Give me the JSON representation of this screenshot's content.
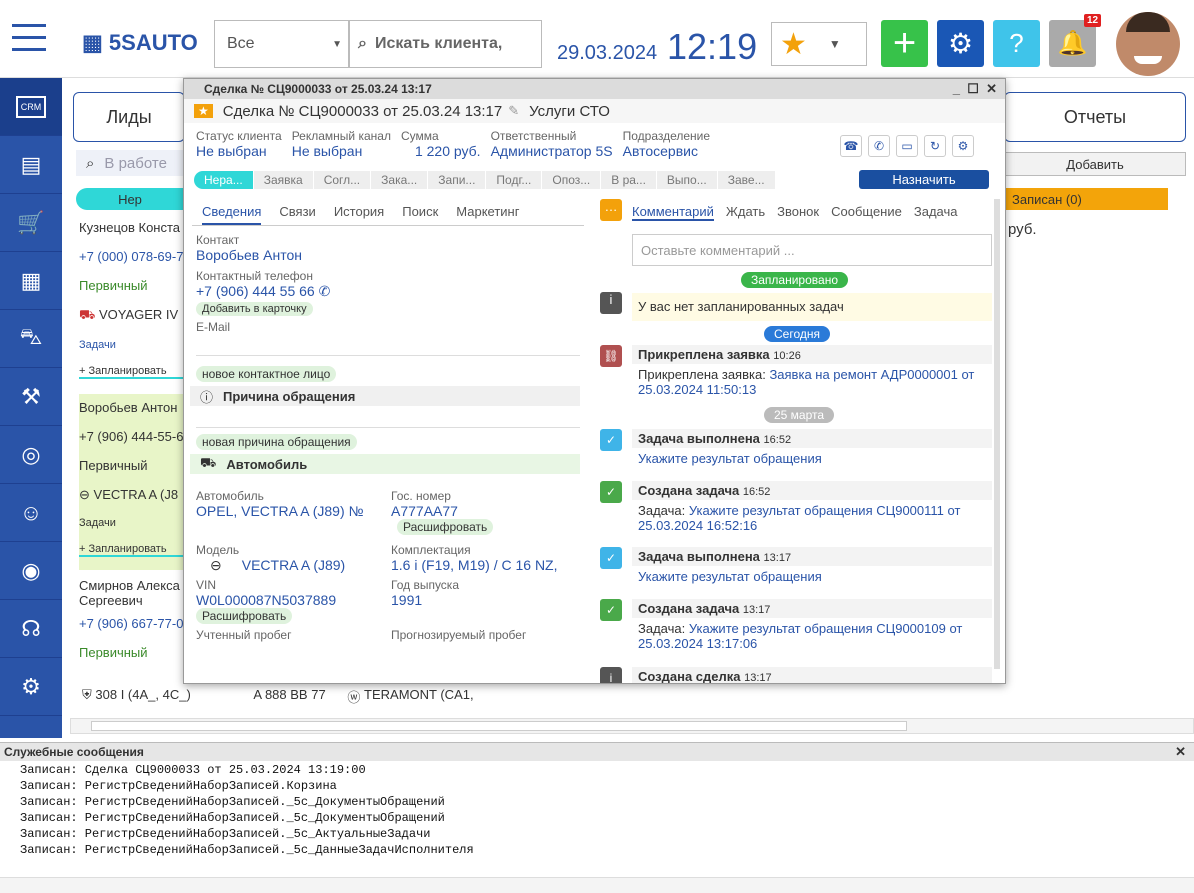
{
  "top": {
    "brand": "5SAUTO",
    "filter_value": "Все",
    "search_placeholder": "Искать клиента,",
    "date": "29.03.2024",
    "time": "12:19",
    "notif_count": "12"
  },
  "tabs": [
    "Лиды",
    "Отчеты"
  ],
  "add_label": "Добавить",
  "list": {
    "search_placeholder": "В работе",
    "first_stage": "Нер",
    "right_stage": "Записан (0)",
    "right_amount": "руб."
  },
  "clients": [
    {
      "name": "Кузнецов Конста",
      "phone": "+7 (000) 078-69-7",
      "type": "Первичный",
      "car": "VOYAGER IV",
      "tasks": "Задачи",
      "plan": "+ Запланировать"
    },
    {
      "name": "Воробьев Антон",
      "phone": "+7 (906) 444-55-6",
      "type": "Первичный",
      "car": "VECTRA A (J8",
      "tasks": "Задачи",
      "plan": "+ Запланировать"
    },
    {
      "name": "Смирнов Алекса Сергеевич",
      "phone": "+7 (906) 667-77-0",
      "type": "Первичный",
      "car": "308 I (4A_, 4C_)",
      "plate": "A 888 BB 77",
      "car2": "TERAMONT (CA1,"
    }
  ],
  "deal": {
    "win_title": "Сделка № СЦ9000033 от 25.03.24 13:17",
    "title": "Сделка № СЦ9000033 от 25.03.24 13:17",
    "service": "Услуги СТО",
    "status_lbl": "Статус клиента",
    "status": "Не выбран",
    "channel_lbl": "Рекламный канал",
    "channel": "Не выбран",
    "sum_lbl": "Сумма",
    "sum": "1 220 руб.",
    "resp_lbl": "Ответственный",
    "resp": "Администратор 5S",
    "dept_lbl": "Подразделение",
    "dept": "Автосервис",
    "assign": "Назначить",
    "steps": [
      "Нера...",
      "Заявка",
      "Согл...",
      "Зака...",
      "Запи...",
      "Подг...",
      "Опоз...",
      "В ра...",
      "Выпо...",
      "Заве..."
    ],
    "left_tabs": [
      "Сведения",
      "Связи",
      "История",
      "Поиск",
      "Маркетинг"
    ],
    "contact_lbl": "Контакт",
    "contact": "Воробьев Антон",
    "phone_lbl": "Контактный телефон",
    "phone": "+7 (906) 444 55 66",
    "add_card": "Добавить в карточку",
    "email_lbl": "E-Mail",
    "new_contact": "новое контактное лицо",
    "reason_hdr": "Причина обращения",
    "new_reason": "новая причина обращения",
    "car_hdr": "Автомобиль",
    "car_lbl": "Автомобиль",
    "car": "OPEL, VECTRA A (J89) №",
    "plate_lbl": "Гос. номер",
    "plate": "A777AA77",
    "decode": "Расшифровать",
    "model_lbl": "Модель",
    "model": "VECTRA A (J89)",
    "equip_lbl": "Комплектация",
    "equip": "1.6 i (F19, M19) / C 16 NZ,",
    "vin_lbl": "VIN",
    "vin": "W0L000087N5037889",
    "year_lbl": "Год выпуска",
    "year": "1991",
    "mileage_lbl": "Учтенный пробег",
    "forecast_lbl": "Прогнозируемый пробег",
    "right_tabs": [
      "Комментарий",
      "Ждать",
      "Звонок",
      "Сообщение",
      "Задача"
    ],
    "comment_placeholder": "Оставьте комментарий ...",
    "planned": "Запланировано",
    "no_tasks": "У вас нет запланированных задач",
    "today": "Сегодня",
    "march25": "25 марта",
    "events": [
      {
        "title": "Прикреплена заявка",
        "time": "10:26",
        "prefix": "Прикреплена заявка:",
        "text": "Заявка на ремонт АДР0000001 от 25.03.2024 11:50:13"
      },
      {
        "title": "Задача выполнена",
        "time": "16:52",
        "prefix": "",
        "text": "Укажите результат обращения"
      },
      {
        "title": "Создана задача",
        "time": "16:52",
        "prefix": "Задача:",
        "text": "Укажите результат обращения СЦ9000111 от 25.03.2024 16:52:16"
      },
      {
        "title": "Задача выполнена",
        "time": "13:17",
        "prefix": "",
        "text": "Укажите результат обращения"
      },
      {
        "title": "Создана задача",
        "time": "13:17",
        "prefix": "Задача:",
        "text": "Укажите результат обращения СЦ9000109 от 25.03.2024 13:17:06"
      },
      {
        "title": "Создана сделка",
        "time": "13:17",
        "prefix": "",
        "text": ""
      }
    ]
  },
  "messages": {
    "title": "Служебные сообщения",
    "lines": [
      "Записан: Сделка СЦ9000033 от 25.03.2024 13:19:00",
      "Записан: РегистрСведенийНаборЗаписей.Корзина",
      "Записан: РегистрСведенийНаборЗаписей._5с_ДокументыОбращений",
      "Записан: РегистрСведенийНаборЗаписей._5с_ДокументыОбращений",
      "Записан: РегистрСведенийНаборЗаписей._5с_АктуальныеЗадачи",
      "Записан: РегистрСведенийНаборЗаписей._5с_ДанныеЗадачИсполнителя"
    ]
  }
}
